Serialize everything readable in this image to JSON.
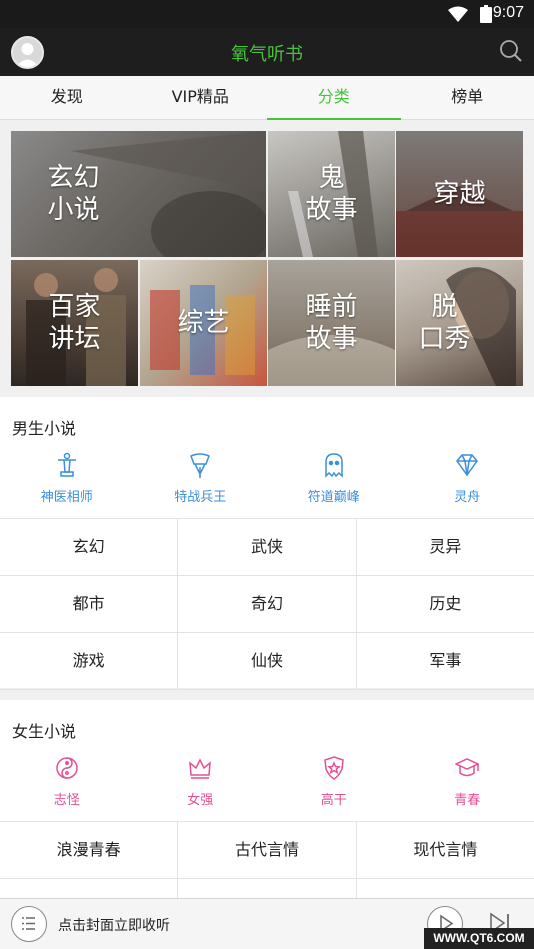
{
  "status_bar": {
    "time": "9:07"
  },
  "header": {
    "title": "氧气听书",
    "avatar_icon": "user-avatar",
    "search_icon": "search-icon"
  },
  "tabs": [
    {
      "label": "发现"
    },
    {
      "label": "VIP精品"
    },
    {
      "label": "分类",
      "active": true
    },
    {
      "label": "榜单"
    }
  ],
  "categories_grid": [
    {
      "label": "玄幻\n小说"
    },
    {
      "label": "鬼\n故事"
    },
    {
      "label": "穿越"
    },
    {
      "label": "百家\n讲坛"
    },
    {
      "label": "综艺"
    },
    {
      "label": "睡前\n故事"
    },
    {
      "label": "脱\n口秀"
    }
  ],
  "male_section": {
    "title": "男生小说",
    "icons": [
      {
        "label": "神医相师",
        "icon": "statue-icon"
      },
      {
        "label": "特战兵王",
        "icon": "badge-icon"
      },
      {
        "label": "符道巅峰",
        "icon": "ghost-icon"
      },
      {
        "label": "灵舟",
        "icon": "diamond-icon"
      }
    ],
    "genres": [
      [
        "玄幻",
        "武侠",
        "灵异"
      ],
      [
        "都市",
        "奇幻",
        "历史"
      ],
      [
        "游戏",
        "仙侠",
        "军事"
      ]
    ]
  },
  "female_section": {
    "title": "女生小说",
    "icons": [
      {
        "label": "志怪",
        "icon": "yin-yang-icon"
      },
      {
        "label": "女强",
        "icon": "crown-icon"
      },
      {
        "label": "高干",
        "icon": "shield-star-icon"
      },
      {
        "label": "青春",
        "icon": "graduation-cap-icon"
      }
    ],
    "genres": [
      [
        "浪漫青春",
        "古代言情",
        "现代言情"
      ]
    ]
  },
  "player": {
    "text": "点击封面立即收听"
  },
  "watermark": "WWW.QT6.COM",
  "colors": {
    "accent_green": "#48c23d",
    "male_blue": "#3b8fd9",
    "female_pink": "#e74e95"
  }
}
